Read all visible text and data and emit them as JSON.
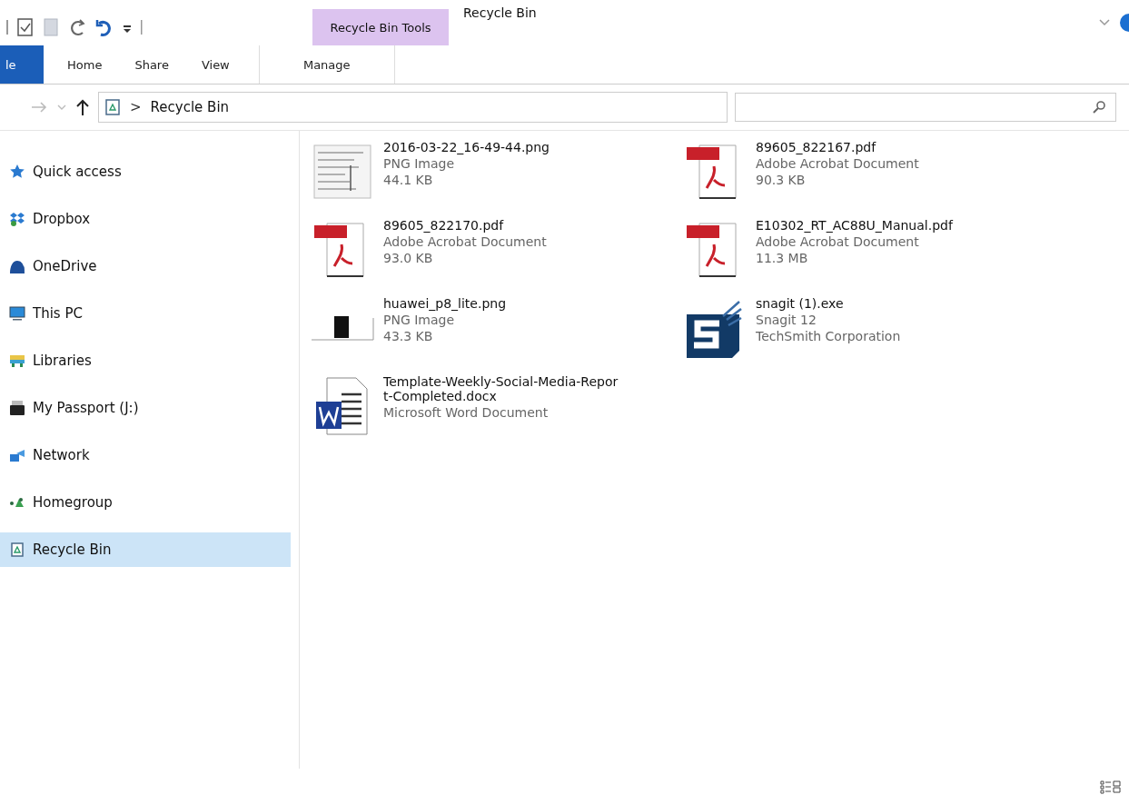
{
  "window": {
    "title": "Recycle Bin"
  },
  "ribbon": {
    "context_group": "Recycle Bin Tools",
    "tabs": [
      {
        "label": "le",
        "kind": "file",
        "selected": false
      },
      {
        "label": "Home",
        "kind": "plain",
        "selected": false
      },
      {
        "label": "Share",
        "kind": "plain",
        "selected": false
      },
      {
        "label": "View",
        "kind": "plain",
        "selected": false
      },
      {
        "label": "Manage",
        "kind": "context",
        "selected": false
      }
    ]
  },
  "address_bar": {
    "separator": ">",
    "location": "Recycle Bin"
  },
  "sidebar": {
    "items": [
      {
        "label": "Quick access",
        "kind": "star",
        "selected": false
      },
      {
        "label": "Dropbox",
        "kind": "dropbox",
        "selected": false
      },
      {
        "label": "OneDrive",
        "kind": "cloud",
        "selected": false
      },
      {
        "label": "This PC",
        "kind": "pc",
        "selected": false
      },
      {
        "label": "Libraries",
        "kind": "library",
        "selected": false
      },
      {
        "label": "My Passport (J:)",
        "kind": "drive",
        "selected": false
      },
      {
        "label": "Network",
        "kind": "network",
        "selected": false
      },
      {
        "label": "Homegroup",
        "kind": "homegroup",
        "selected": false
      },
      {
        "label": "Recycle Bin",
        "kind": "recycle",
        "selected": true
      }
    ]
  },
  "files": [
    {
      "name": "2016-03-22_16-49-44.png",
      "kind": "screenshot",
      "lines": [
        "PNG Image",
        "44.1 KB"
      ]
    },
    {
      "name": "89605_822167.pdf",
      "kind": "pdf",
      "lines": [
        "Adobe Acrobat Document",
        "90.3 KB"
      ]
    },
    {
      "name": "89605_822170.pdf",
      "kind": "pdf",
      "lines": [
        "Adobe Acrobat Document",
        "93.0 KB"
      ]
    },
    {
      "name": "E10302_RT_AC88U_Manual.pdf",
      "kind": "pdf",
      "lines": [
        "Adobe Acrobat Document",
        "11.3 MB"
      ]
    },
    {
      "name": "huawei_p8_lite.png",
      "kind": "photo",
      "lines": [
        "PNG Image",
        "43.3 KB"
      ]
    },
    {
      "name": "snagit (1).exe",
      "kind": "exe",
      "lines": [
        "Snagit 12",
        "TechSmith Corporation"
      ]
    },
    {
      "name": "Template-Weekly-Social-Media-Report-Completed.docx",
      "kind": "word",
      "lines": [
        "Microsoft Word Document"
      ]
    }
  ]
}
